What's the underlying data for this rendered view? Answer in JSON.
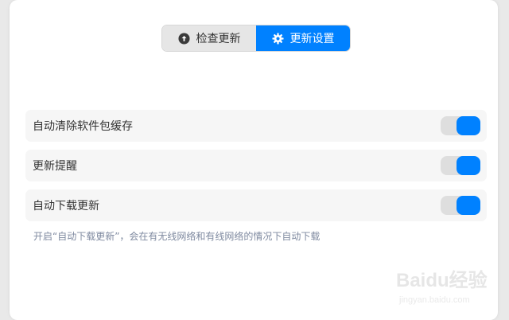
{
  "tabs": [
    {
      "label": "检查更新",
      "icon": "arrow-up-circle-icon",
      "active": false
    },
    {
      "label": "更新设置",
      "icon": "gear-icon",
      "active": true
    }
  ],
  "settings": [
    {
      "label": "自动清除软件包缓存",
      "enabled": true
    },
    {
      "label": "更新提醒",
      "enabled": true
    },
    {
      "label": "自动下载更新",
      "enabled": true
    }
  ],
  "hint": "开启“自动下载更新”，会在有无线网络和有线网络的情况下自动下载",
  "watermark": {
    "brand": "Baidu经验",
    "url": "jingyan.baidu.com"
  },
  "colors": {
    "accent": "#0081ff",
    "inactive_tab": "#e6e6e6",
    "row_bg": "#f6f6f6",
    "hint_text": "#7f8aa0"
  }
}
